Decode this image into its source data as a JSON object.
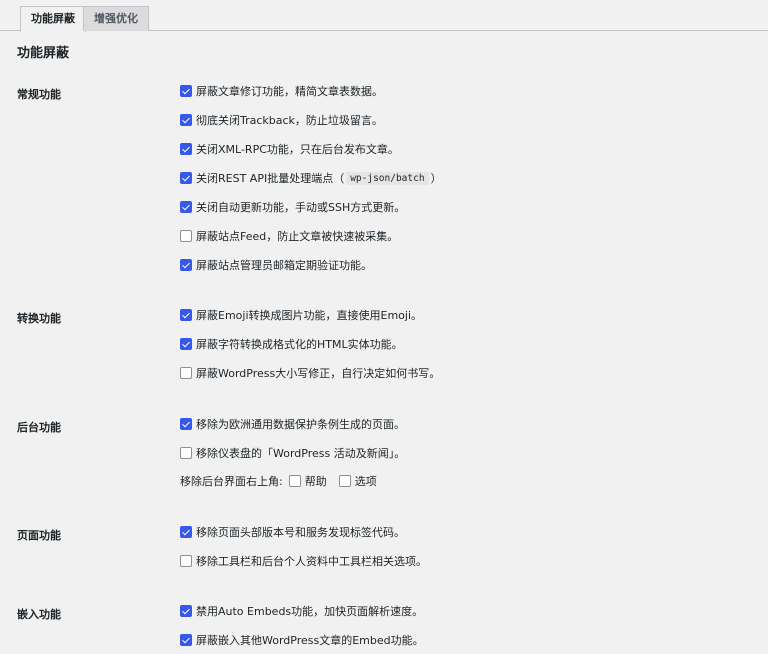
{
  "tabs": [
    {
      "label": "功能屏蔽",
      "active": true
    },
    {
      "label": "增强优化",
      "active": false
    }
  ],
  "page_title": "功能屏蔽",
  "sections": {
    "general": {
      "label": "常规功能",
      "items": [
        {
          "label": "屏蔽文章修订功能，精简文章表数据。",
          "checked": true
        },
        {
          "label": "彻底关闭Trackback，防止垃圾留言。",
          "checked": true
        },
        {
          "label": "关闭XML-RPC功能，只在后台发布文章。",
          "checked": true
        },
        {
          "label_before": "关闭REST API批量处理端点（",
          "code": "wp-json/batch",
          "label_after": "）",
          "checked": true
        },
        {
          "label": "关闭自动更新功能，手动或SSH方式更新。",
          "checked": true
        },
        {
          "label": "屏蔽站点Feed，防止文章被快速被采集。",
          "checked": false
        },
        {
          "label": "屏蔽站点管理员邮箱定期验证功能。",
          "checked": true
        }
      ]
    },
    "convert": {
      "label": "转换功能",
      "items": [
        {
          "label": "屏蔽Emoji转换成图片功能，直接使用Emoji。",
          "checked": true
        },
        {
          "label": "屏蔽字符转换成格式化的HTML实体功能。",
          "checked": true
        },
        {
          "label": "屏蔽WordPress大小写修正，自行决定如何书写。",
          "checked": false
        }
      ]
    },
    "admin": {
      "label": "后台功能",
      "items": [
        {
          "label": "移除为欧洲通用数据保护条例生成的页面。",
          "checked": true
        },
        {
          "label": "移除仪表盘的「WordPress 活动及新闻」。",
          "checked": false
        }
      ],
      "corner_label": "移除后台界面右上角:",
      "corner_options": [
        {
          "label": "帮助",
          "checked": false
        },
        {
          "label": "选项",
          "checked": false
        }
      ]
    },
    "frontend": {
      "label": "页面功能",
      "items": [
        {
          "label": "移除页面头部版本号和服务发现标签代码。",
          "checked": true
        },
        {
          "label": "移除工具栏和后台个人资料中工具栏相关选项。",
          "checked": false
        }
      ]
    },
    "embed": {
      "label": "嵌入功能",
      "items": [
        {
          "label": "禁用Auto Embeds功能，加快页面解析速度。",
          "checked": true
        },
        {
          "label": "屏蔽嵌入其他WordPress文章的Embed功能。",
          "checked": true
        }
      ]
    }
  }
}
